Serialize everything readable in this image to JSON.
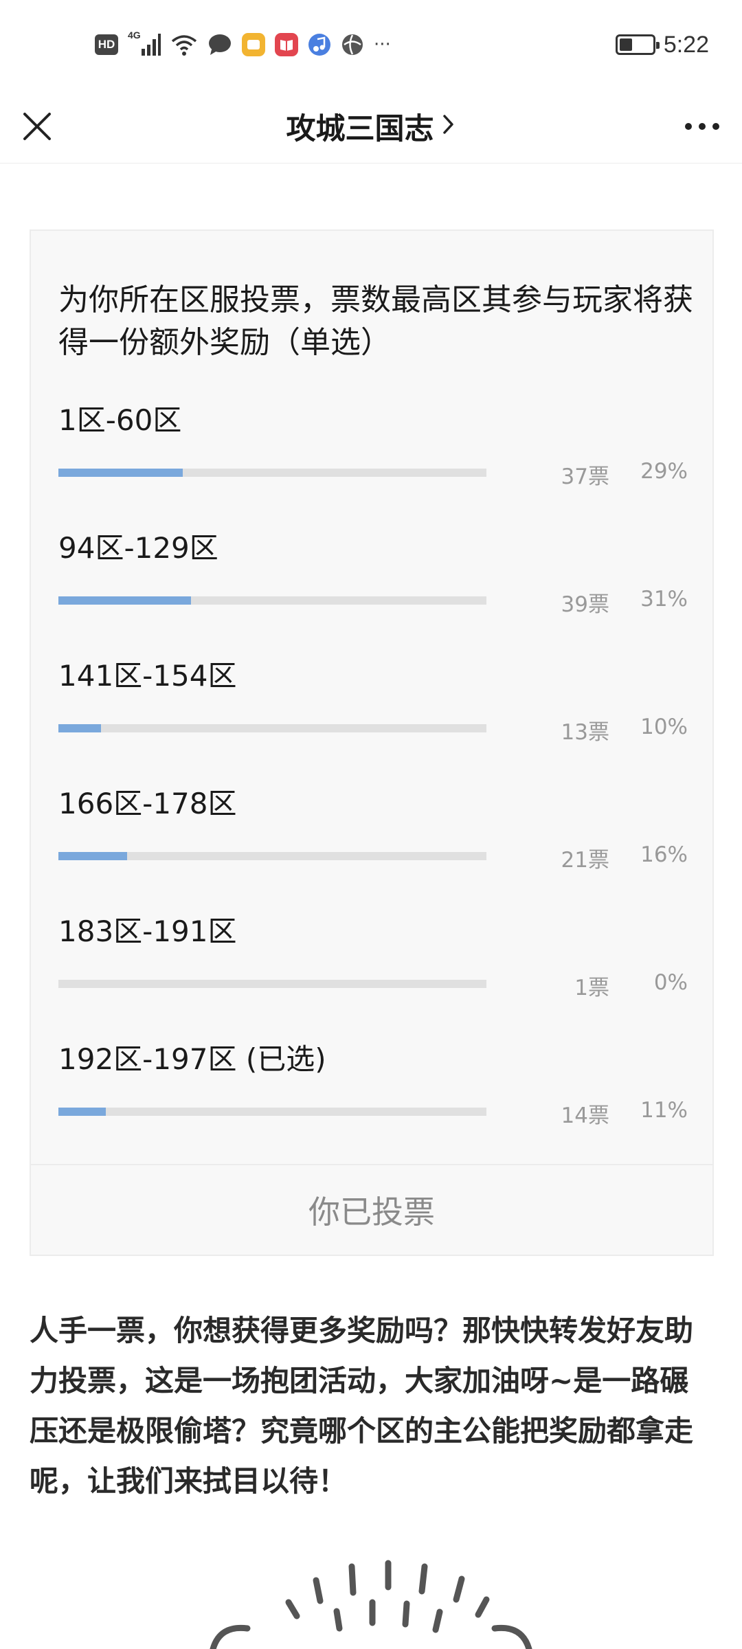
{
  "status_bar": {
    "hd": "HD",
    "network": "4G",
    "more": "···",
    "time": "5:22"
  },
  "nav": {
    "title": "攻城三国志",
    "chevron": ">"
  },
  "poll": {
    "question": "为你所在区服投票，票数最高区其参与玩家将获得一份额外奖励（单选）",
    "options": [
      {
        "label": "1区-60区",
        "votes": "37票",
        "percent": "29%",
        "fill": 0.29
      },
      {
        "label": "94区-129区",
        "votes": "39票",
        "percent": "31%",
        "fill": 0.31
      },
      {
        "label": "141区-154区",
        "votes": "13票",
        "percent": "10%",
        "fill": 0.1
      },
      {
        "label": "166区-178区",
        "votes": "21票",
        "percent": "16%",
        "fill": 0.16
      },
      {
        "label": "183区-191区",
        "votes": "1票",
        "percent": "0%",
        "fill": 0.0
      },
      {
        "label": "192区-197区 (已选)",
        "votes": "14票",
        "percent": "11%",
        "fill": 0.11
      }
    ],
    "voted_label": "你已投票"
  },
  "article": {
    "paragraph": "人手一票，你想获得更多奖励吗？那快快转发好友助力投票，这是一场抱团活动，大家加油呀~是一路碾压还是极限偷塔？究竟哪个区的主公能把奖励都拿走呢，让我们来拭目以待！"
  },
  "colors": {
    "bar_fill": "#7aa8dc",
    "bar_track": "#e0e0e0",
    "card_bg": "#f8f8f8"
  },
  "icons": {
    "close": "close-icon",
    "more": "more-icon",
    "chevron": "chevron-right-icon"
  }
}
